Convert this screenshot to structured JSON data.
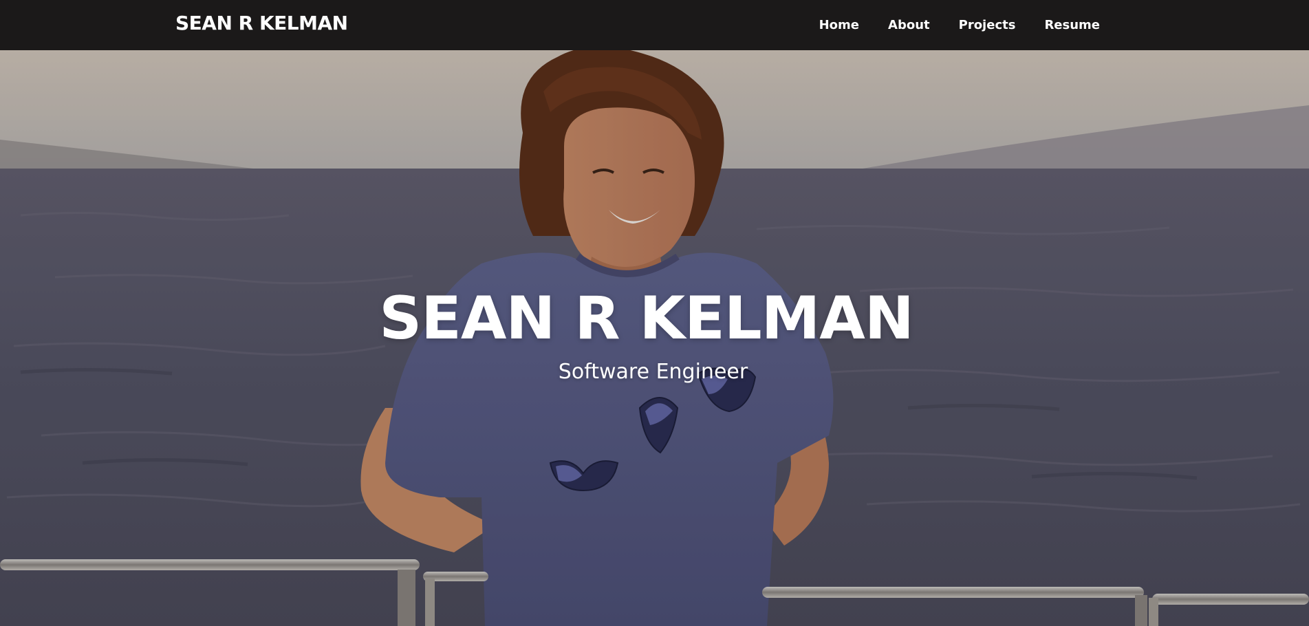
{
  "navbar": {
    "brand": "SEAN R KELMAN",
    "links": [
      "Home",
      "About",
      "Projects",
      "Resume"
    ]
  },
  "hero": {
    "title": "SEAN R KELMAN",
    "subtitle": "Software Engineer",
    "photo": "portrait-on-boat-at-sea"
  },
  "colors": {
    "navbar_bg": "#1b1919",
    "text": "#ffffff",
    "shirt": "#5b5f86",
    "sea": "#5f6072",
    "sky": "#c9c2b8"
  }
}
